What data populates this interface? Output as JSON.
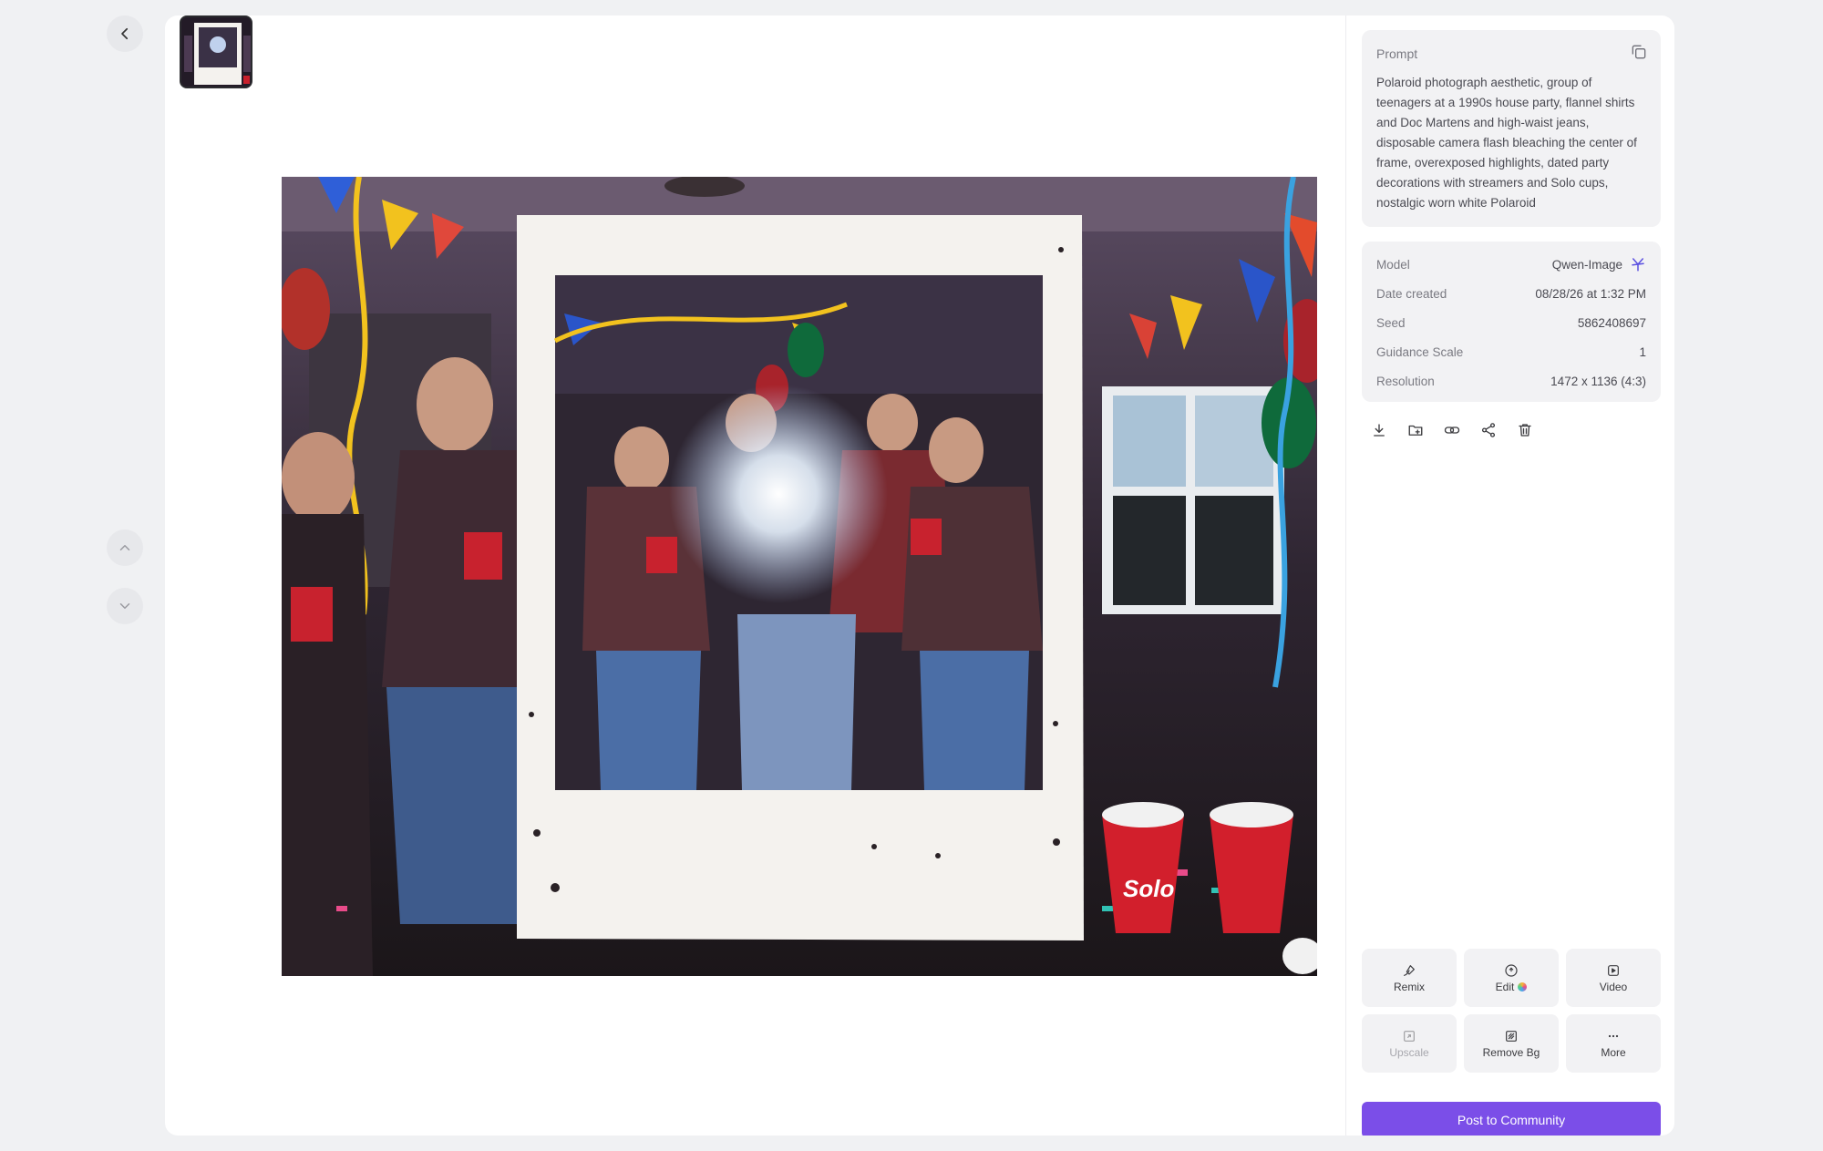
{
  "prompt": {
    "label": "Prompt",
    "text": "Polaroid photograph aesthetic, group of teenagers at a 1990s house party, flannel shirts and Doc Martens and high-waist jeans, disposable camera flash bleaching the center of frame, overexposed highlights, dated party decorations with streamers and Solo cups, nostalgic worn white Polaroid"
  },
  "meta": {
    "model_label": "Model",
    "model_value": "Qwen-Image",
    "date_label": "Date created",
    "date_value": "08/28/26 at 1:32 PM",
    "seed_label": "Seed",
    "seed_value": "5862408697",
    "guidance_label": "Guidance Scale",
    "guidance_value": "1",
    "resolution_label": "Resolution",
    "resolution_value": "1472 x 1136 (4:3)"
  },
  "tools": {
    "remix": "Remix",
    "edit": "Edit",
    "video": "Video",
    "upscale": "Upscale",
    "remove_bg": "Remove Bg",
    "more": "More"
  },
  "post_button": "Post to Community",
  "photo_text": {
    "cup_label": "Solo"
  },
  "colors": {
    "accent": "#7b4ee8",
    "panel": "#f2f2f4",
    "background": "#f0f1f3"
  },
  "icons": {
    "back": "chevron-left-icon",
    "prev": "chevron-up-icon",
    "next": "chevron-down-icon",
    "copy": "copy-icon",
    "download": "download-icon",
    "folder": "folder-plus-icon",
    "link": "link-icon",
    "share": "share-icon",
    "delete": "trash-icon"
  }
}
